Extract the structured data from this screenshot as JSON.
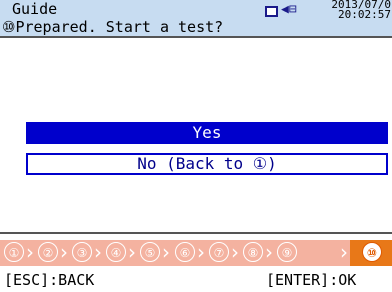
{
  "header": {
    "title": "Guide",
    "subtitle": "⑩Prepared. Start a test?",
    "date": "2013/07/0",
    "time": "20:02:57"
  },
  "options": [
    {
      "label": "Yes",
      "selected": true
    },
    {
      "label": "No (Back to ①)",
      "selected": false
    }
  ],
  "steps": [
    "①",
    "②",
    "③",
    "④",
    "⑤",
    "⑥",
    "⑦",
    "⑧",
    "⑨",
    "⑩"
  ],
  "active_step": "⑩",
  "footer": {
    "esc": "[ESC]:BACK",
    "enter": "[ENTER]:OK"
  },
  "colors": {
    "header_bg": "#c7dcf1",
    "selected_bg": "#0000cc",
    "step_bar_bg": "#f4b2a0",
    "active_step_bg": "#e87818"
  },
  "icons": {
    "battery": "battery-icon",
    "power": "ac-power-plug-icon"
  }
}
